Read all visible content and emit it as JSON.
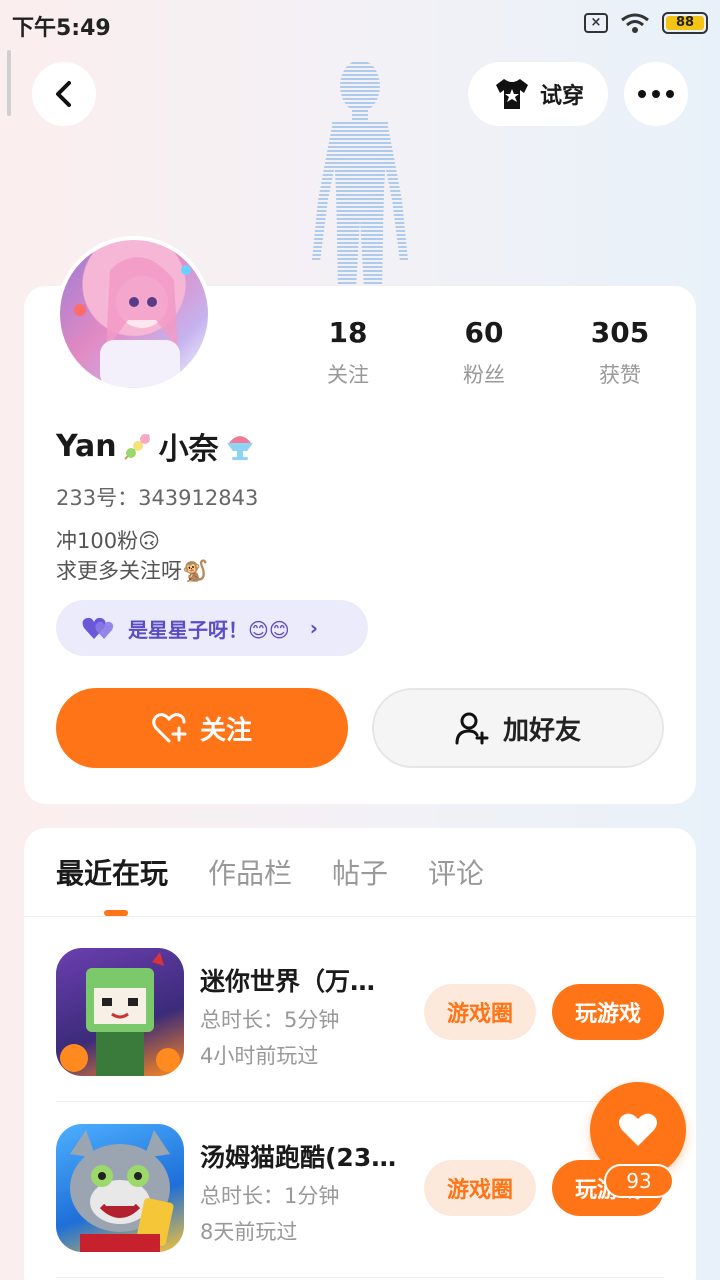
{
  "status_bar": {
    "time": "下午5:49",
    "battery": "88"
  },
  "nav": {
    "tryon_label": "试穿"
  },
  "stats": [
    {
      "value": "18",
      "label": "关注"
    },
    {
      "value": "60",
      "label": "粉丝"
    },
    {
      "value": "305",
      "label": "获赞"
    }
  ],
  "profile": {
    "name_prefix": "Yan",
    "name_suffix": "小奈",
    "id_text": "233号：343912843",
    "bio_line1": "冲100粉🙃",
    "bio_line2": "求更多关注呀🐒",
    "pill_text": "是星星子呀！😊😊"
  },
  "actions": {
    "follow": "关注",
    "add_friend": "加好友"
  },
  "tabs": [
    "最近在玩",
    "作品栏",
    "帖子",
    "评论"
  ],
  "games": [
    {
      "title": "迷你世界（万…",
      "duration": "总时长：5分钟",
      "last": "4小时前玩过",
      "circle": "游戏圈",
      "play": "玩游戏"
    },
    {
      "title": "汤姆猫跑酷(23…",
      "duration": "总时长：1分钟",
      "last": "8天前玩过",
      "circle": "游戏圈",
      "play": "玩游戏"
    }
  ],
  "float_like": {
    "count": "93"
  },
  "colors": {
    "accent": "#ff7416",
    "pill_bg": "#ecebfb",
    "pill_text": "#5a4ec4"
  }
}
